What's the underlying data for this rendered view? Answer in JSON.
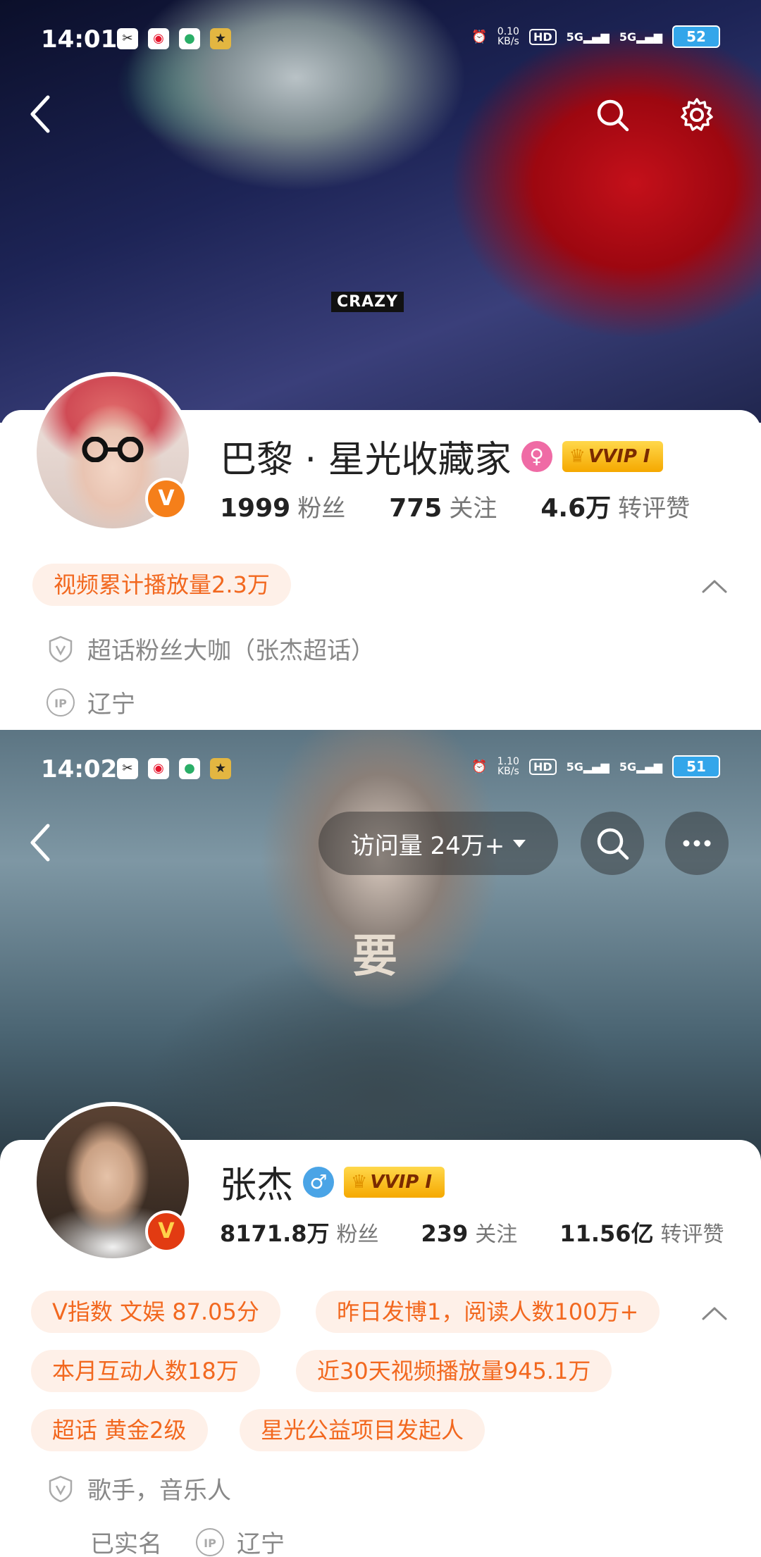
{
  "screen1": {
    "status": {
      "time": "14:01",
      "net_speed": "0.10",
      "net_unit": "KB/s",
      "hd": "HD",
      "sig1": "5G",
      "sig2": "5G",
      "battery": "52"
    },
    "banner": {
      "logo_text": "CRAZY"
    },
    "profile": {
      "name": "巴黎 · 星光收藏家",
      "vvip": "VVIP I",
      "followers_num": "1999",
      "followers_label": "粉丝",
      "following_num": "775",
      "following_label": "关注",
      "engage_num": "4.6万",
      "engage_label": "转评赞"
    },
    "tags": [
      "视频累计播放量2.3万"
    ],
    "info": {
      "supertopic": "超话粉丝大咖（张杰超话）",
      "ip_label": "IP",
      "location": "辽宁"
    }
  },
  "screen2": {
    "status": {
      "time": "14:02",
      "net_speed": "1.10",
      "net_unit": "KB/s",
      "hd": "HD",
      "sig1": "5G",
      "sig2": "5G",
      "battery": "51"
    },
    "header": {
      "visits": "访问量 24万+"
    },
    "banner": {
      "poster_title": "要"
    },
    "profile": {
      "name": "张杰",
      "vvip": "VVIP I",
      "followers_num": "8171.8万",
      "followers_label": "粉丝",
      "following_num": "239",
      "following_label": "关注",
      "engage_num": "11.56亿",
      "engage_label": "转评赞"
    },
    "tags": [
      "V指数 文娱 87.05分",
      "昨日发博1，阅读人数100万+",
      "本月互动人数18万",
      "近30天视频播放量945.1万",
      "超话 黄金2级",
      "星光公益项目发起人"
    ],
    "info": {
      "occupation": "歌手，音乐人",
      "verified": "已实名",
      "ip_label": "IP",
      "location": "辽宁"
    }
  },
  "colors": {
    "accent_orange": "#f2681f",
    "tag_bg": "#fef0e8",
    "vvip_gold": "#f5a800"
  }
}
